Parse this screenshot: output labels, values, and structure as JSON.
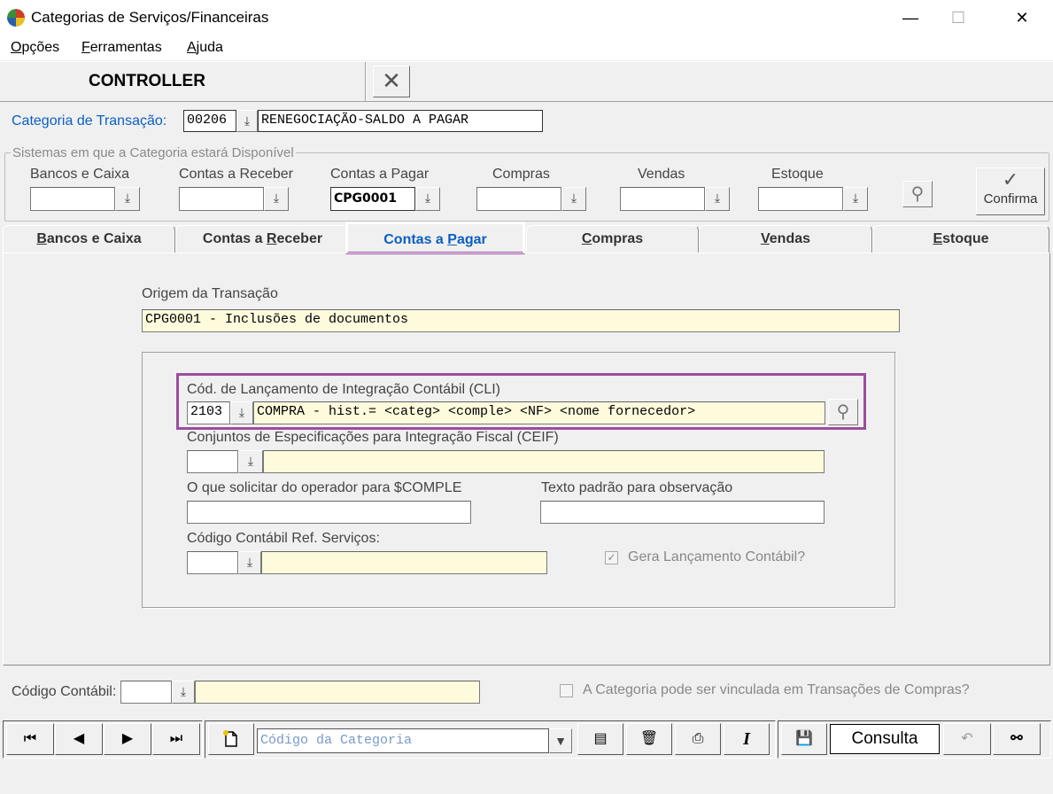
{
  "window": {
    "title": "Categorias de Serviços/Financeiras",
    "minimize": "—",
    "maximize": "☐",
    "close": "✕"
  },
  "menu": {
    "opcoes": "pções",
    "opcoes_key": "O",
    "ferramentas": "erramentas",
    "ferramentas_key": "F",
    "ajuda": "juda",
    "ajuda_key": "A"
  },
  "header": {
    "title": "CONTROLLER",
    "close_symbol": "✕"
  },
  "categoria": {
    "label": "Categoria de Transação:",
    "code": "00206",
    "description": "RENEGOCIAÇÃO-SALDO A PAGAR"
  },
  "sistemas": {
    "group_label": "Sistemas em que a Categoria estará Disponível",
    "bancos_label": "Bancos e Caixa",
    "bancos_value": "",
    "receber_label": "Contas a Receber",
    "receber_value": "",
    "pagar_label": "Contas a Pagar",
    "pagar_value": "CPG0001",
    "compras_label": "Compras",
    "compras_value": "",
    "vendas_label": "Vendas",
    "vendas_value": "",
    "estoque_label": "Estoque",
    "estoque_value": "",
    "confirma_label": "Confirma"
  },
  "tabs": {
    "bancos_pre": "",
    "bancos_key": "B",
    "bancos_post": "ancos e Caixa",
    "receber_pre": "Contas a ",
    "receber_key": "R",
    "receber_post": "eceber",
    "pagar_pre": "Contas a ",
    "pagar_key": "P",
    "pagar_post": "agar",
    "compras_key": "C",
    "compras_post": "ompras",
    "vendas_key": "V",
    "vendas_post": "endas",
    "estoque_key": "E",
    "estoque_post": "stoque"
  },
  "panel": {
    "origem_label": "Origem da Transação",
    "origem_value": "CPG0001 - Inclusões de documentos",
    "cli_label": "Cód. de Lançamento de Integração Contábil (CLI)",
    "cli_code": "2103",
    "cli_desc": "COMPRA - hist.= <categ> <comple> <NF> <nome fornecedor>",
    "ceif_label": "Conjuntos de Especificações para Integração Fiscal  (CEIF)",
    "ceif_code": "",
    "ceif_desc": "",
    "comple_label": "O que solicitar do operador para $COMPLE",
    "comple_value": "",
    "obs_label": "Texto padrão para observação",
    "obs_value": "",
    "ref_label": "Código Contábil Ref. Serviços:",
    "ref_code": "",
    "ref_desc": "",
    "gera_label": "Gera Lançamento Contábil?"
  },
  "footer": {
    "codigo_label": "Código Contábil:",
    "codigo_code": "",
    "codigo_desc": "",
    "vinculo_label": "A Categoria pode ser vinculada em Transações de Compras?"
  },
  "toolbar": {
    "first": "⏮",
    "prev": "◀",
    "next": "▶",
    "last": "⏭",
    "search_placeholder": "Código da Categoria",
    "consulta": "Consulta",
    "italic": "I"
  }
}
